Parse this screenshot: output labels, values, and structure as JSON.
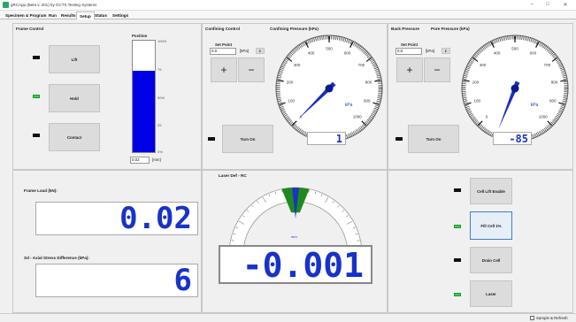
{
  "window": {
    "title": "gRCApp (Beta v. 201) by GCTS Testing Systems",
    "min": "–",
    "max": "□",
    "close": "✕"
  },
  "tabs": [
    "Specimen & Program",
    "Run",
    "Results",
    "Setup",
    "Status",
    "Settings"
  ],
  "frame": {
    "header": "Frame Control",
    "lift": "Lift",
    "hold": "Hold",
    "contact": "Contact",
    "position_label": "Position",
    "position_ticks": [
      "100%",
      "75",
      "50%",
      "25",
      "0%"
    ],
    "position_fraction": 0.73,
    "position_value": "0.02",
    "position_unit": "[mm]"
  },
  "confining": {
    "header": "Confining Control",
    "gauge_title": "Confining Pressure (kPa)",
    "setpoint_label": "Set Point",
    "setpoint_value": "0.0",
    "unit": "[kPa]",
    "send": "Σ",
    "plus": "+",
    "minus": "−",
    "turn_on": "Turn On",
    "gauge_ticks": [
      "0",
      "100",
      "200",
      "300",
      "400",
      "500",
      "600",
      "700",
      "800",
      "900",
      "1000"
    ],
    "gauge_unit": "kPa",
    "gauge_value": 1,
    "display": "1"
  },
  "back": {
    "header": "Back Pressure",
    "gauge_title": "Pore Pressure (kPa)",
    "setpoint_label": "Set Point",
    "setpoint_value": "0.0",
    "unit": "[kPa]",
    "send": "Σ",
    "plus": "+",
    "minus": "−",
    "turn_on": "Turn On",
    "gauge_ticks": [
      "0",
      "100",
      "200",
      "300",
      "400",
      "500",
      "600",
      "700",
      "800",
      "900",
      "1000"
    ],
    "gauge_unit": "kPa",
    "gauge_value": -85,
    "display": "-85"
  },
  "load": {
    "frame_load_label": "Frame Load (kN):",
    "frame_load": "0.02",
    "sd_label": "Sd - Axial Stress Difference (kPa):",
    "sd": "6"
  },
  "laser": {
    "header": "Laser Def - RC",
    "unit": "mm",
    "display": "-0.001"
  },
  "right": {
    "cell_lift": "Cell Lift Enable",
    "fill_cell": "Fill Cell 1%",
    "drain": "Drain Cell",
    "laser": "Laser"
  },
  "status": {
    "left": "",
    "sample_refresh": "Sample & Refresh"
  },
  "colors": {
    "accent": "#1932c8",
    "led_on": "#34d34a",
    "bar": "#0000e6",
    "needle": "#1a2fbf",
    "laser_green": "#1e8a1e"
  }
}
